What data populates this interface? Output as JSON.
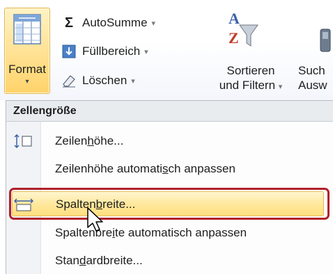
{
  "ribbon": {
    "format": {
      "label": "Format",
      "arrow": "▾",
      "icon": "format-cells-icon"
    },
    "autosumme": {
      "label": "AutoSumme",
      "icon": "sigma-icon",
      "dropdown": "▾"
    },
    "fuellbereich": {
      "label": "Füllbereich",
      "icon": "fill-down-icon",
      "dropdown": "▾"
    },
    "loeschen": {
      "label": "Löschen",
      "icon": "eraser-icon",
      "dropdown": "▾"
    },
    "sortieren": {
      "line1": "Sortieren",
      "line2": "und Filtern",
      "dropdown": "▾",
      "icon": "sort-filter-icon"
    },
    "suchen": {
      "line1": "Such",
      "line2": "Ausw",
      "icon": "binoculars-icon"
    }
  },
  "menu": {
    "header": "Zellengröße",
    "items": [
      {
        "pre": "Zeilen",
        "accel": "h",
        "post": "öhe...",
        "icon": "row-height-icon"
      },
      {
        "pre": "Zeilenhöhe automati",
        "accel": "s",
        "post": "ch anpassen",
        "icon": ""
      },
      {
        "pre": "Spalten",
        "accel": "b",
        "post": "reite...",
        "icon": "column-width-icon"
      },
      {
        "pre": "Spaltenbre",
        "accel": "i",
        "post": "te automatisch anpassen",
        "icon": ""
      },
      {
        "pre": "Stan",
        "accel": "d",
        "post": "ardbreite...",
        "icon": ""
      }
    ]
  },
  "colors": {
    "highlight_border": "#b0202a",
    "hover_fill": "#ffe79a"
  }
}
